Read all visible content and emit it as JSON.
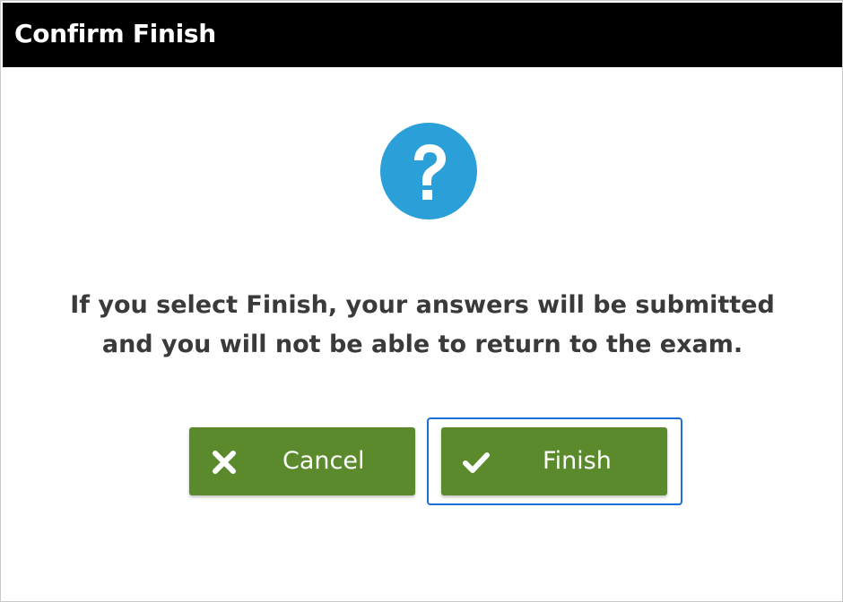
{
  "dialog": {
    "title": "Confirm Finish",
    "icon": "question-circle-icon",
    "message_line1": "If you select Finish, your answers will be submitted",
    "message_line2": "and you will not be able to return to the exam.",
    "cancel_label": "Cancel",
    "cancel_icon": "close-icon",
    "finish_label": "Finish",
    "finish_icon": "checkmark-icon",
    "focused_button": "finish"
  },
  "colors": {
    "titlebar": "#000000",
    "title_text": "#ffffff",
    "icon_circle": "#2a9fd8",
    "message_text": "#3a3a3a",
    "button": "#5b8a2c",
    "focus_ring": "#1c6fd6"
  }
}
